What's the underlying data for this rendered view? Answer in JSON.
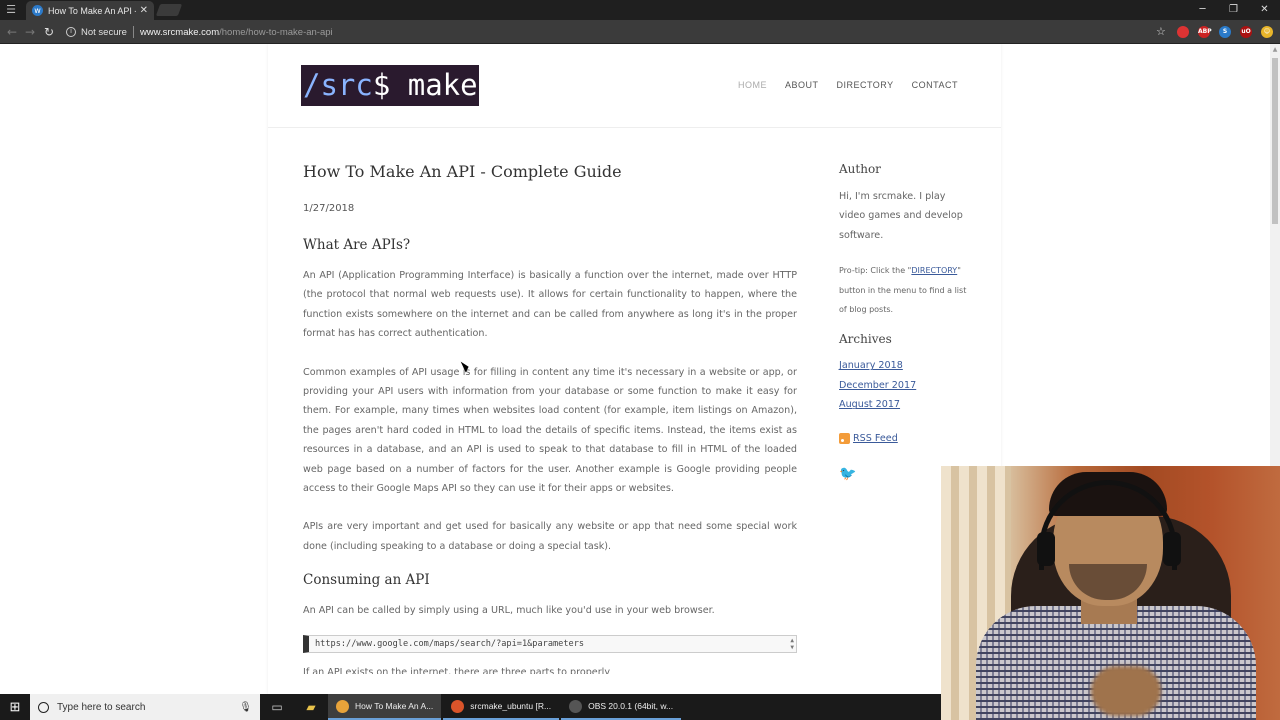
{
  "browser": {
    "tab_title": "How To Make An API - C",
    "close_glyph": "✕",
    "not_secure": "Not secure",
    "url_host": "www.srcmake.com",
    "url_path": "/home/how-to-make-an-api",
    "window_controls": [
      "─",
      "❐",
      "✕"
    ],
    "extensions": [
      {
        "name": "opera-icon",
        "label": "",
        "color": "#d33"
      },
      {
        "name": "adblock-icon",
        "label": "ABP",
        "color": "#c22"
      },
      {
        "name": "extension-blue-icon",
        "label": "S",
        "color": "#2a7ac9"
      },
      {
        "name": "ublock-icon",
        "label": "uO",
        "color": "#a11"
      },
      {
        "name": "emoji-icon",
        "label": "☺",
        "color": "#e8b52a"
      }
    ]
  },
  "site": {
    "logo_path": "/src",
    "logo_rest": "$ make",
    "nav": [
      "HOME",
      "ABOUT",
      "DIRECTORY",
      "CONTACT"
    ]
  },
  "post": {
    "title": "How To Make An API - Complete Guide",
    "date": "1/27/2018",
    "h_what": "What Are APIs?",
    "p1": "An API (Application Programming Interface) is basically a function over the internet, made over HTTP (the protocol that normal web requests use). It allows for certain functionality to happen, where the function exists somewhere on the internet and can be called from anywhere as long it's in the proper format has has correct authentication.",
    "p2": "Common examples of API usage is for filling in content any time it's necessary in a website or app, or providing your API users with information from your database or some function to make it easy for them. For example, many times when websites load content (for example, item listings on Amazon), the pages aren't hard coded in HTML to load the details of specific items. Instead, the items exist as resources in a database, and an API is used to speak to that database to fill in HTML of the loaded web page based on a number of factors for the user. Another example is Google providing people access to their Google Maps API so they can use it for their apps or websites.",
    "p3": "APIs are very important and get used for basically any website or app that need some special work done (including speaking to a database or doing a special task).",
    "h_consuming": "Consuming an API",
    "p4": "An API can be called by simply using a URL, much like you'd use in your web browser.",
    "code": "https://www.google.com/maps/search/?api=1&parameters",
    "p5_cut": "If an API exists on the internet, there are three parts to properly"
  },
  "sidebar": {
    "author_heading": "Author",
    "author_text": "Hi, I'm srcmake. I play video games and develop software.",
    "protip_pre": "Pro-tip: Click the \"",
    "protip_link": "DIRECTORY",
    "protip_post": "\" button in the menu to find a list of blog posts.",
    "archives_heading": "Archives",
    "archives": [
      "January 2018",
      "December 2017",
      "August 2017"
    ],
    "rss": "RSS Feed"
  },
  "taskbar": {
    "search_placeholder": "Type here to search",
    "apps": [
      {
        "label": "How To Make An A...",
        "color": "#e8a33a",
        "active": true
      },
      {
        "label": "srcmake_ubuntu [R...",
        "color": "#d9542a",
        "active": false
      },
      {
        "label": "OBS 20.0.1 (64bit, w...",
        "color": "#555",
        "active": false
      }
    ]
  }
}
